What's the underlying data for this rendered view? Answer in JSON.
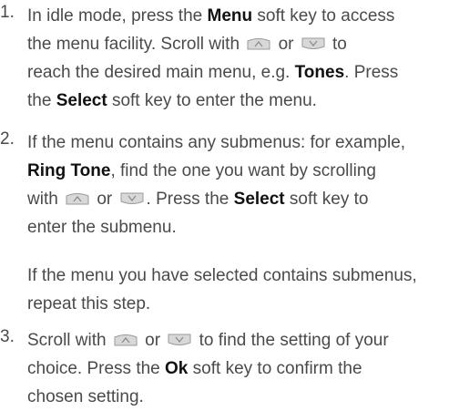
{
  "steps": [
    {
      "number": "1.",
      "lines": [
        [
          {
            "t": "In idle mode, press the "
          },
          {
            "b": "Menu"
          },
          {
            "t": " soft key to access"
          }
        ],
        [
          {
            "t": "the menu facility. Scroll with "
          },
          {
            "icon": "up-key-icon"
          },
          {
            "t": " or "
          },
          {
            "icon": "down-key-icon"
          },
          {
            "t": " to"
          }
        ],
        [
          {
            "t": "reach the desired main menu, e.g. "
          },
          {
            "b": "Tones"
          },
          {
            "t": ". Press"
          }
        ],
        [
          {
            "t": "the "
          },
          {
            "b": "Select"
          },
          {
            "t": " soft key to enter the menu."
          }
        ]
      ]
    },
    {
      "number": "2.",
      "lines": [
        [
          {
            "t": "If the menu contains any submenus: for example,"
          }
        ],
        [
          {
            "b": "Ring Tone"
          },
          {
            "t": ", find the one you want by scrolling"
          }
        ],
        [
          {
            "t": "with "
          },
          {
            "icon": "up-key-icon"
          },
          {
            "t": " or "
          },
          {
            "icon": "down-key-icon"
          },
          {
            "t": ". Press the "
          },
          {
            "b": "Select"
          },
          {
            "t": " soft key to"
          }
        ],
        [
          {
            "t": "enter the submenu."
          }
        ]
      ],
      "note": [
        "If the menu you have selected contains submenus,",
        "repeat this step."
      ]
    },
    {
      "number": "3.",
      "lines": [
        [
          {
            "t": "Scroll with "
          },
          {
            "icon": "up-key-icon"
          },
          {
            "t": " or "
          },
          {
            "icon": "down-key-icon"
          },
          {
            "t": " to find the setting of your"
          }
        ],
        [
          {
            "t": "choice. Press the "
          },
          {
            "b": "Ok"
          },
          {
            "t": " soft key to confirm the"
          }
        ],
        [
          {
            "t": "chosen setting."
          }
        ]
      ]
    }
  ],
  "colors": {
    "text": "#4a4a4a",
    "bold": "#111111",
    "key_fill": "#d8d8d8",
    "key_stroke": "#9a9a9a"
  }
}
